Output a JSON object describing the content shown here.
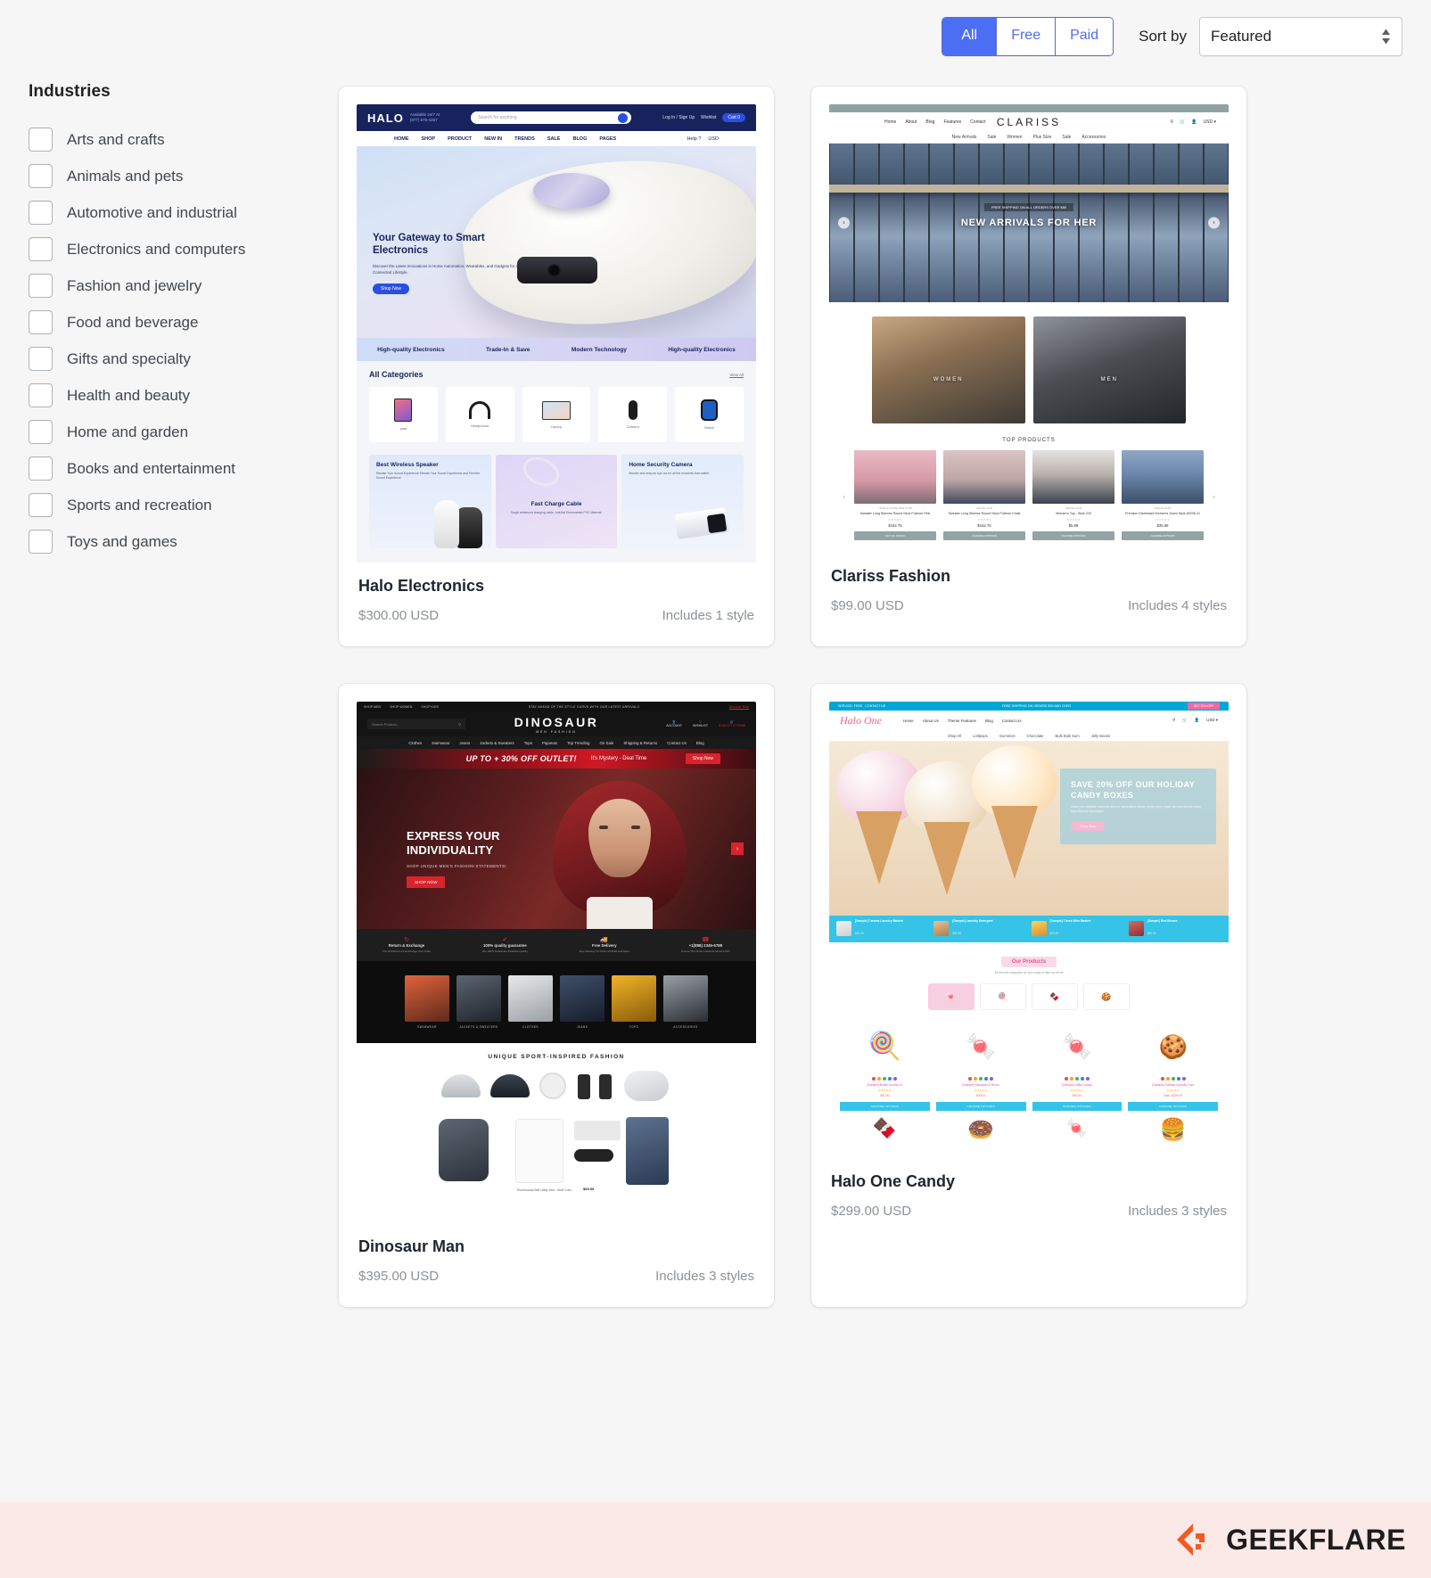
{
  "toolbar": {
    "filters": [
      {
        "label": "All",
        "active": true
      },
      {
        "label": "Free",
        "active": false
      },
      {
        "label": "Paid",
        "active": false
      }
    ],
    "sort_label": "Sort by",
    "sort_value": "Featured"
  },
  "sidebar": {
    "title": "Industries",
    "items": [
      {
        "label": "Arts and crafts",
        "checked": false
      },
      {
        "label": "Animals and pets",
        "checked": false
      },
      {
        "label": "Automotive and industrial",
        "checked": false
      },
      {
        "label": "Electronics and computers",
        "checked": false
      },
      {
        "label": "Fashion and jewelry",
        "checked": false
      },
      {
        "label": "Food and beverage",
        "checked": false
      },
      {
        "label": "Gifts and specialty",
        "checked": false
      },
      {
        "label": "Health and beauty",
        "checked": false
      },
      {
        "label": "Home and garden",
        "checked": false
      },
      {
        "label": "Books and entertainment",
        "checked": false
      },
      {
        "label": "Sports and recreation",
        "checked": false
      },
      {
        "label": "Toys and games",
        "checked": false
      }
    ]
  },
  "cards": [
    {
      "title": "Halo Electronics",
      "price": "$300.00 USD",
      "styles": "Includes 1 style"
    },
    {
      "title": "Clariss Fashion",
      "price": "$99.00 USD",
      "styles": "Includes 4 styles"
    },
    {
      "title": "Dinosaur Man",
      "price": "$395.00 USD",
      "styles": "Includes 3 styles"
    },
    {
      "title": "Halo One Candy",
      "price": "$299.00 USD",
      "styles": "Includes 3 styles"
    }
  ],
  "preview_halo": {
    "logo": "HALO",
    "contact_line1": "Available 24/7 At",
    "contact_line2": "(877) 676-4357",
    "search_placeholder": "Search for anything",
    "login": "Log In / Sign Up",
    "wishlist": "Wishlist",
    "cart": "Cart 0",
    "nav": [
      "HOME",
      "SHOP",
      "PRODUCT",
      "NEW IN",
      "TRENDS",
      "SALE",
      "BLOG",
      "PAGES"
    ],
    "nav_right": [
      "Help ?",
      "USD"
    ],
    "hero_title": "Your Gateway to Smart Electronics",
    "hero_text": "Discover the Latest Innovations in Home Automation, Wearables, and Gadgets for a Connected Lifestyle.",
    "hero_cta": "Shop Now",
    "strip": [
      "High-quality Electronics",
      "Trade-In & Save",
      "Modern Technology",
      "High-quality Electronics"
    ],
    "cats_title": "All Categories",
    "cats_link": "View All",
    "categories": [
      "Ipad",
      "Headphone",
      "Laptop",
      "Camera",
      "Watch"
    ],
    "promos": [
      {
        "title": "Best Wireless Speaker",
        "text": "Elevate Your Sound Experience Elevate Your Sound Experience and Feel the Sound Experience."
      },
      {
        "title": "Fast Charge Cable",
        "text": "Tough reinforced charging cable. Anti-flat Electrostatic PVC Material."
      },
      {
        "title": "Home Security Camera",
        "text": "Monitor and keep an eye out for all the moments that matter."
      }
    ]
  },
  "preview_clariss": {
    "logo": "CLARISS",
    "nav": [
      "Home",
      "About",
      "Blog",
      "Features",
      "Contact"
    ],
    "subnav": [
      "New Arrivals",
      "Sale",
      "Women",
      "Plus Size",
      "Sale",
      "Accessories"
    ],
    "hero_sub": "FREE SHIPPING ON ALL ORDERS OVER $50",
    "hero_title": "NEW ARRIVALS FOR HER",
    "tiles": [
      "WOMEN",
      "MEN"
    ],
    "top_products_title": "TOP PRODUCTS",
    "products": [
      {
        "brand": "LINDA & LOUISE PINE CLUB",
        "name": "Sweater Long Sleeves Round Neck Pullover Pink",
        "price": "$162.75",
        "cta": "OUT OF STOCK"
      },
      {
        "brand": "GRACE CLUB",
        "name": "Sweater Long Sleeves Round Neck Pullover Khaki",
        "price": "$162.75",
        "cta": "CHOOSE OPTIONS"
      },
      {
        "brand": "GRACE CLUB",
        "name": "Women's Top - Style 229",
        "price": "$5.99",
        "cta": "CHOOSE OPTIONS"
      },
      {
        "brand": "GRACE CLUB",
        "name": "Premium Distressed Women's Jeans Style 82035-41",
        "price": "$35.99",
        "cta": "CHOOSE OPTIONS"
      }
    ]
  },
  "preview_dinosaur": {
    "logo": "DINOSAUR",
    "logo_sub": "MEN FASHION",
    "top_tabs": [
      "SHOP MEN",
      "SHOP WOMEN",
      "SHOP KIDS"
    ],
    "top_mid": "STAY AHEAD OF THE STYLE CURVE WITH OUR LATEST ARRIVALS",
    "top_link": "Discover Now",
    "search_placeholder": "Search Product...",
    "icons": [
      "ACCOUNT",
      "WISHLIST",
      "$108.00 / 3 ITEMS"
    ],
    "nav": [
      "Clothes",
      "Swimwear",
      "Jeans",
      "Jackets & Sweaters",
      "Tops",
      "Pajamas",
      "Top Trending",
      "On Sale",
      "Shipping & Returns",
      "Contact Us",
      "Blog"
    ],
    "promo_main": "UP TO + 30% OFF OUTLET!",
    "promo_sub": "It's Mystery - Deal Time",
    "promo_cta": "Shop Now",
    "hero_title": "EXPRESS YOUR INDIVIDUALITY",
    "hero_sub": "SHOP UNIQUE MEN'S FASHION STATEMENTS!",
    "hero_cta": "SHOP NOW",
    "features": [
      {
        "title": "Return & Exchange",
        "text": "The Gift Return Or Exchange Your Order"
      },
      {
        "title": "100% quality guarantee",
        "text": "We 100% Guarantee Products Quality"
      },
      {
        "title": "Free Delivery",
        "text": "Free Delivery On Order Of $100 And More"
      },
      {
        "title": "+1(888) 2345-6789",
        "text": "Around The Clock Customer Service 24/7"
      }
    ],
    "categories": [
      "SWIMWEAR",
      "JACKETS & SWEATERS",
      "CLOTHES",
      "JEANS",
      "TOPS",
      "ACCESSORIES"
    ],
    "bottom_title": "UNIQUE SPORT-INSPIRED FASHION",
    "bottom_price": "$69.99",
    "bottom_label": "Runnerwear Belt Utility Vest - Multi Color"
  },
  "preview_haloone": {
    "logo": "Halo One",
    "top_left": "SERVICE: FREE",
    "top_left2": "CONTACT US",
    "top_mid": "FREE SHIPPING ON ORDERS $39 AND OVER",
    "top_right": "GET 20% OFF",
    "nav": [
      "Home",
      "About Us",
      "Theme Features",
      "Blog",
      "Contact Us"
    ],
    "subnav": [
      "Shop All",
      "Lollipops",
      "Gummies",
      "Chocolate",
      "Bulk Bulk Sum",
      "Jelly Beans"
    ],
    "icons": [
      "search",
      "cart",
      "account",
      "USD"
    ],
    "banner_title": "SAVE 20% OFF OUR HOLIDAY CANDY BOXES",
    "banner_text": "Share your sweetest moments with our handcrafted holiday candy boxes, made with love and the finest ingredients for the season.",
    "banner_cta": "Shop Now",
    "strip": [
      {
        "name": "[Sample] Canvas Laundry Basket",
        "price": "$49.99"
      },
      {
        "name": "[Sample] Laundry Detergent",
        "price": "$39.99"
      },
      {
        "name": "[Sample] Tiered Wire Basket",
        "price": "$29.99"
      },
      {
        "name": "[Sample] Red Blouse",
        "price": "$59.99"
      }
    ],
    "products_title": "Our Products",
    "products_sub": "All the best categories for your sugar to take our friend",
    "products": [
      {
        "name": "[Sample] Bottle Journal 12",
        "price": "$32.00"
      },
      {
        "name": "[Sample] Marzipan & Brook",
        "price": "$39.00"
      },
      {
        "name": "[Sample] Utility Caddy",
        "price": "$49.00"
      },
      {
        "name": "[Sample] Kansas Laundry Cart",
        "price": "Now: $399.00"
      }
    ],
    "product_cta": "CHOOSE OPTIONS"
  },
  "footer": {
    "brand": "GEEKFLARE"
  },
  "colors": {
    "accent": "#4c6ef5",
    "page_bg": "#f6f6f7",
    "card_bg": "#ffffff",
    "muted_text": "#8c9196",
    "footer_bg": "#fbe9e7",
    "geekflare_orange": "#f15a22"
  }
}
